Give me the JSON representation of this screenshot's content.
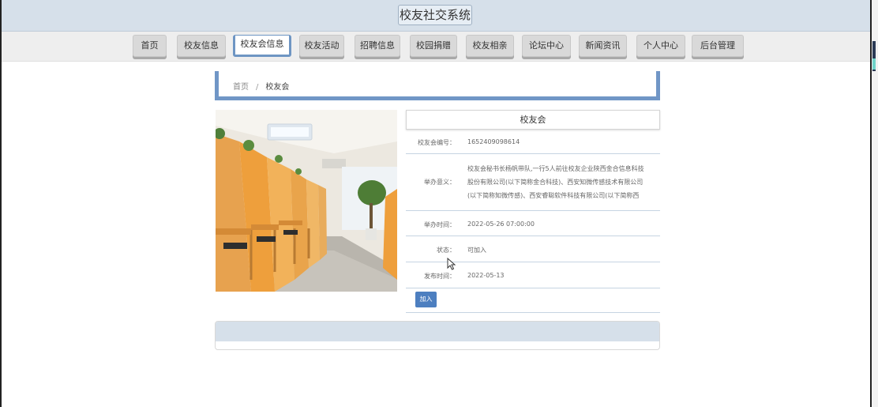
{
  "site": {
    "title": "校友社交系统"
  },
  "nav": {
    "items": [
      "首页",
      "校友信息",
      "校友会信息",
      "校友活动",
      "招聘信息",
      "校园捐赠",
      "校友相亲",
      "论坛中心",
      "新闻资讯",
      "个人中心",
      "后台管理"
    ],
    "active": "校友会信息"
  },
  "breadcrumb": {
    "home": "首页",
    "separator": "/",
    "current": "校友会"
  },
  "detail": {
    "title": "校友会",
    "fields": {
      "number_label": "校友会编号：",
      "number_value": "1652409098614",
      "meaning_label": "举办意义：",
      "meaning_lines": [
        "校友会秘书长杨帆带队,一行5人前往校友企业陕西金合信息科技",
        "股份有限公司(以下简称金合科技)、西安知微传感技术有限公司",
        "(以下简称知微传感)、西安睿聪软件科技有限公司(以下简称西"
      ],
      "time_label": "举办时间：",
      "time_value": "2022-05-26 07:00:00",
      "status_label": "状态：",
      "status_value": "可加入",
      "publish_label": "发布时间：",
      "publish_value": "2022-05-13"
    },
    "join_button": "加入"
  },
  "icons": {
    "cursor": "mouse-pointer-icon"
  },
  "colors": {
    "accent": "#7096c6",
    "button": "#4d7fc0",
    "header_bg": "#d6e0ea"
  }
}
